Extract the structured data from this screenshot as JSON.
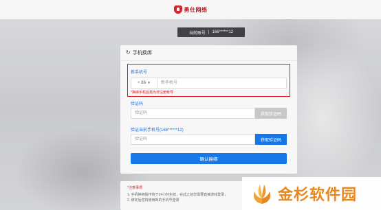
{
  "header": {
    "brand": "勇仕网络"
  },
  "account_bar": {
    "label": "当前账号",
    "separator": "|",
    "value": "166******12"
  },
  "card": {
    "title": "手机换绑",
    "new_phone": {
      "label": "新手机号",
      "country_code": "+ 86",
      "placeholder": "新手机号",
      "hint": "*换绑手机后需为非注册帐号"
    },
    "verify_new": {
      "label": "验证码",
      "placeholder": "验证码",
      "button": "获取验证码"
    },
    "verify_current": {
      "label": "验证当前手机号(166******12)",
      "placeholder": "验证码",
      "button": "获取验证码"
    },
    "confirm_button": "确认换绑"
  },
  "notice": {
    "title": "*注意事项",
    "lines": [
      "1. 手机换绑操作将于24小时生效，在此之前您需要直接游戏登录，",
      "2. 绑定后您将使用新的手机号登录"
    ]
  },
  "watermark": {
    "text": "金杉软件园"
  },
  "colors": {
    "accent": "#1677e8",
    "warning": "#e0141c",
    "brand": "#d6232a",
    "watermark": "#e8871e"
  }
}
